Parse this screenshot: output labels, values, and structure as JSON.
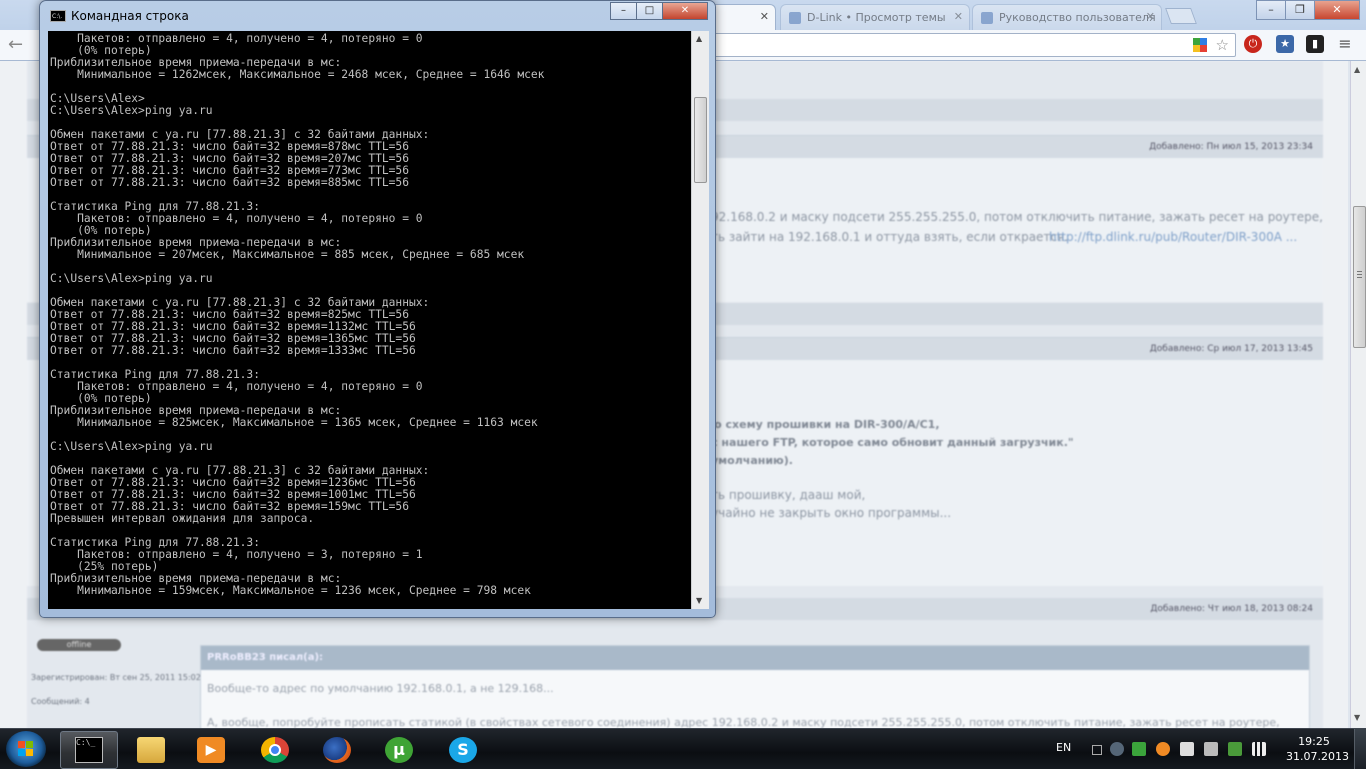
{
  "browser": {
    "tabs": [
      {
        "label": "…",
        "active": false
      },
      {
        "label": "…",
        "active": true
      },
      {
        "label": "D-Link • Просмотр темы",
        "active": false
      },
      {
        "label": "Руководство пользователя",
        "active": false
      }
    ]
  },
  "cmd": {
    "title": "Командная строка",
    "icon_text": "C:\\.",
    "lines": [
      "    Пакетов: отправлено = 4, получено = 4, потеряно = 0",
      "    (0% потерь)",
      "Приблизительное время приема-передачи в мс:",
      "    Минимальное = 1262мсек, Максимальное = 2468 мсек, Среднее = 1646 мсек",
      "",
      "C:\\Users\\Alex>",
      "C:\\Users\\Alex>ping ya.ru",
      "",
      "Обмен пакетами с ya.ru [77.88.21.3] с 32 байтами данных:",
      "Ответ от 77.88.21.3: число байт=32 время=878мс TTL=56",
      "Ответ от 77.88.21.3: число байт=32 время=207мс TTL=56",
      "Ответ от 77.88.21.3: число байт=32 время=773мс TTL=56",
      "Ответ от 77.88.21.3: число байт=32 время=885мс TTL=56",
      "",
      "Статистика Ping для 77.88.21.3:",
      "    Пакетов: отправлено = 4, получено = 4, потеряно = 0",
      "    (0% потерь)",
      "Приблизительное время приема-передачи в мс:",
      "    Минимальное = 207мсек, Максимальное = 885 мсек, Среднее = 685 мсек",
      "",
      "C:\\Users\\Alex>ping ya.ru",
      "",
      "Обмен пакетами с ya.ru [77.88.21.3] с 32 байтами данных:",
      "Ответ от 77.88.21.3: число байт=32 время=825мс TTL=56",
      "Ответ от 77.88.21.3: число байт=32 время=1132мс TTL=56",
      "Ответ от 77.88.21.3: число байт=32 время=1365мс TTL=56",
      "Ответ от 77.88.21.3: число байт=32 время=1333мс TTL=56",
      "",
      "Статистика Ping для 77.88.21.3:",
      "    Пакетов: отправлено = 4, получено = 4, потеряно = 0",
      "    (0% потерь)",
      "Приблизительное время приема-передачи в мс:",
      "    Минимальное = 825мсек, Максимальное = 1365 мсек, Среднее = 1163 мсек",
      "",
      "C:\\Users\\Alex>ping ya.ru",
      "",
      "Обмен пакетами с ya.ru [77.88.21.3] с 32 байтами данных:",
      "Ответ от 77.88.21.3: число байт=32 время=1236мс TTL=56",
      "Ответ от 77.88.21.3: число байт=32 время=1001мс TTL=56",
      "Ответ от 77.88.21.3: число байт=32 время=159мс TTL=56",
      "Превышен интервал ожидания для запроса.",
      "",
      "Статистика Ping для 77.88.21.3:",
      "    Пакетов: отправлено = 4, получено = 3, потеряно = 1",
      "    (25% потерь)",
      "Приблизительное время приема-передачи в мс:",
      "    Минимальное = 159мсек, Максимальное = 1236 мсек, Среднее = 798 мсек"
    ]
  },
  "forum": {
    "posts": [
      {
        "meta": "Добавлено: Пн июл 15, 2013 23:34",
        "text1": "92.168.0.2 и маску подсети 255.255.255.0, потом отключить питание, зажать ресет на роутере,",
        "text2": "ть зайти на 192.168.0.1 и оттуда взять, если открается.",
        "link": "http://ftp.dlink.ru/pub/Router/DIR-300A ..."
      },
      {
        "meta": "Добавлено: Ср июл 17, 2013 13:45",
        "b1": "ю схему прошивки на DIR-300/A/C1,",
        "b2": "с нашего FTP, которое само обновит данный загрузчик.\"",
        "b3": "умолчанию).",
        "t1": "ть прошивку, дааш мой,",
        "t2": "учайно не закрыть окно программы..."
      },
      {
        "meta": "Добавлено: Чт июл 18, 2013 08:24",
        "status": "offline",
        "registered": "Зарегистрирован: Вт сен 25, 2011 15:02",
        "messages": "Сообщений: 4",
        "quote_head": "PRRoBB23 писал(а):",
        "quote1": "Вообще-то адрес по умолчанию 192.168.0.1, а не 129.168...",
        "quote2": "А, вообще, попробуйте прописать статикой (в свойствах сетевого соединения) адрес 192.168.0.2 и маску подсети 255.255.255.0, потом отключить питание, зажать ресет на роутере,"
      }
    ]
  },
  "taskbar": {
    "language": "EN",
    "time": "19:25",
    "date": "31.07.2013"
  }
}
